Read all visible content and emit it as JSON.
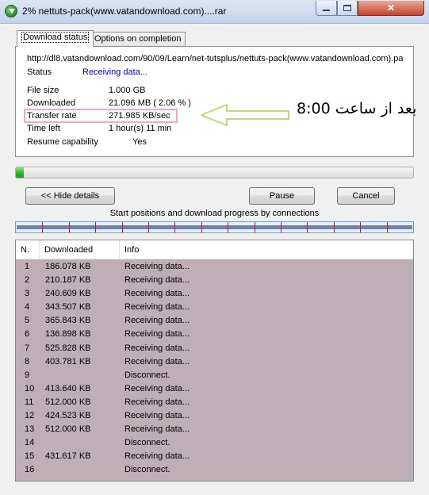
{
  "window": {
    "title": "2% nettuts-pack(www.vatandownload.com)....rar",
    "close_glyph": "✕"
  },
  "tabs": [
    {
      "label": "Download status",
      "active": true
    },
    {
      "label": "Options on completion",
      "active": false
    }
  ],
  "status_panel": {
    "url": "http://dl8.vatandownload.com/90/09/Learn/net-tutsplus/nettuts-pack(www.vatandownload.com).pa",
    "status_label": "Status",
    "status_value": "Receiving data...",
    "file_size_label": "File size",
    "file_size_value": "1.000  GB",
    "downloaded_label": "Downloaded",
    "downloaded_value": "21.096  MB  ( 2.06 % )",
    "transfer_rate_label": "Transfer rate",
    "transfer_rate_value": "271.985  KB/sec",
    "time_left_label": "Time left",
    "time_left_value": "1 hour(s) 11 min",
    "resume_label": "Resume capability",
    "resume_value": "Yes"
  },
  "annotation": {
    "text": "بعد از ساعت 8:00",
    "arrow_color": "#b6e06a",
    "box_color": "#f4a6c6"
  },
  "progress": {
    "fraction": 0.0206
  },
  "buttons": {
    "hide_details": "<< Hide details",
    "pause": "Pause",
    "cancel": "Cancel"
  },
  "connections": {
    "caption": "Start positions and download progress by connections",
    "segment_count": 15
  },
  "list": {
    "columns": [
      "N.",
      "Downloaded",
      "Info"
    ],
    "rows": [
      {
        "n": "1",
        "downloaded": "186.078  KB",
        "info": "Receiving data..."
      },
      {
        "n": "2",
        "downloaded": "210.187  KB",
        "info": "Receiving data..."
      },
      {
        "n": "3",
        "downloaded": "240.609  KB",
        "info": "Receiving data..."
      },
      {
        "n": "4",
        "downloaded": "343.507  KB",
        "info": "Receiving data..."
      },
      {
        "n": "5",
        "downloaded": "365.843  KB",
        "info": "Receiving data..."
      },
      {
        "n": "6",
        "downloaded": "136.898  KB",
        "info": "Receiving data..."
      },
      {
        "n": "7",
        "downloaded": "525.828  KB",
        "info": "Receiving data..."
      },
      {
        "n": "8",
        "downloaded": "403.781  KB",
        "info": "Receiving data..."
      },
      {
        "n": "9",
        "downloaded": "",
        "info": "Disconnect."
      },
      {
        "n": "10",
        "downloaded": "413.640  KB",
        "info": "Receiving data..."
      },
      {
        "n": "11",
        "downloaded": "512.000  KB",
        "info": "Receiving data..."
      },
      {
        "n": "12",
        "downloaded": "424.523  KB",
        "info": "Receiving data..."
      },
      {
        "n": "13",
        "downloaded": "512.000  KB",
        "info": "Receiving data..."
      },
      {
        "n": "14",
        "downloaded": "",
        "info": "Disconnect."
      },
      {
        "n": "15",
        "downloaded": "431.617  KB",
        "info": "Receiving data..."
      },
      {
        "n": "16",
        "downloaded": "",
        "info": "Disconnect."
      }
    ]
  }
}
